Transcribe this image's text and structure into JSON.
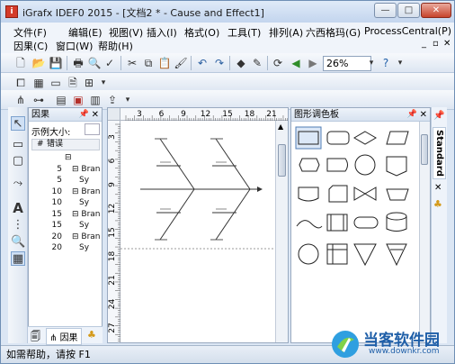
{
  "window": {
    "title": "iGrafx IDEF0 2015 - [文档2 * - Cause and Effect1]",
    "app_icon": "igrafx-logo-icon",
    "buttons": [
      "minimize",
      "maximize",
      "close"
    ]
  },
  "menubar": {
    "row1": [
      "文件(F)",
      "编辑(E)",
      "视图(V)",
      "插入(I)",
      "格式(O)",
      "工具(T)",
      "排列(A)",
      "六西格玛(G)",
      "ProcessCentral(P)"
    ],
    "row2": [
      "因果(C)",
      "窗口(W)",
      "帮助(H)"
    ]
  },
  "toolbar": {
    "zoom_value": "26%"
  },
  "left_panel": {
    "title": "因果",
    "sample_label": "示例大小:",
    "col_header_num": "#",
    "col_header_label": "错误",
    "rows": [
      {
        "num": "",
        "label": "⊟",
        "indent": 0
      },
      {
        "num": "5",
        "label": "⊟ Bran",
        "indent": 1
      },
      {
        "num": "5",
        "label": "Sy",
        "indent": 2
      },
      {
        "num": "10",
        "label": "⊟ Bran",
        "indent": 1
      },
      {
        "num": "10",
        "label": "Sy",
        "indent": 2
      },
      {
        "num": "15",
        "label": "⊟ Bran",
        "indent": 1
      },
      {
        "num": "15",
        "label": "Sy",
        "indent": 2
      },
      {
        "num": "20",
        "label": "⊟ Bran",
        "indent": 1
      },
      {
        "num": "20",
        "label": "Sy",
        "indent": 2
      }
    ],
    "tab_label": "因果"
  },
  "ruler": {
    "top_labels": [
      "3",
      "6",
      "9",
      "12",
      "15",
      "18",
      "21"
    ],
    "left_labels": [
      "3",
      "6",
      "9",
      "12",
      "15",
      "18",
      "21",
      "24",
      "27"
    ]
  },
  "palette": {
    "title": "图形调色板",
    "side_tab": "Standard"
  },
  "status": {
    "text": "如需帮助，请按 F1"
  },
  "watermark": {
    "brand": "当客软件园",
    "url": "www.downkr.com"
  },
  "colors": {
    "titlebar": "#c3d5ee",
    "close_button": "#c7432c",
    "accent": "#1f5fa8"
  }
}
